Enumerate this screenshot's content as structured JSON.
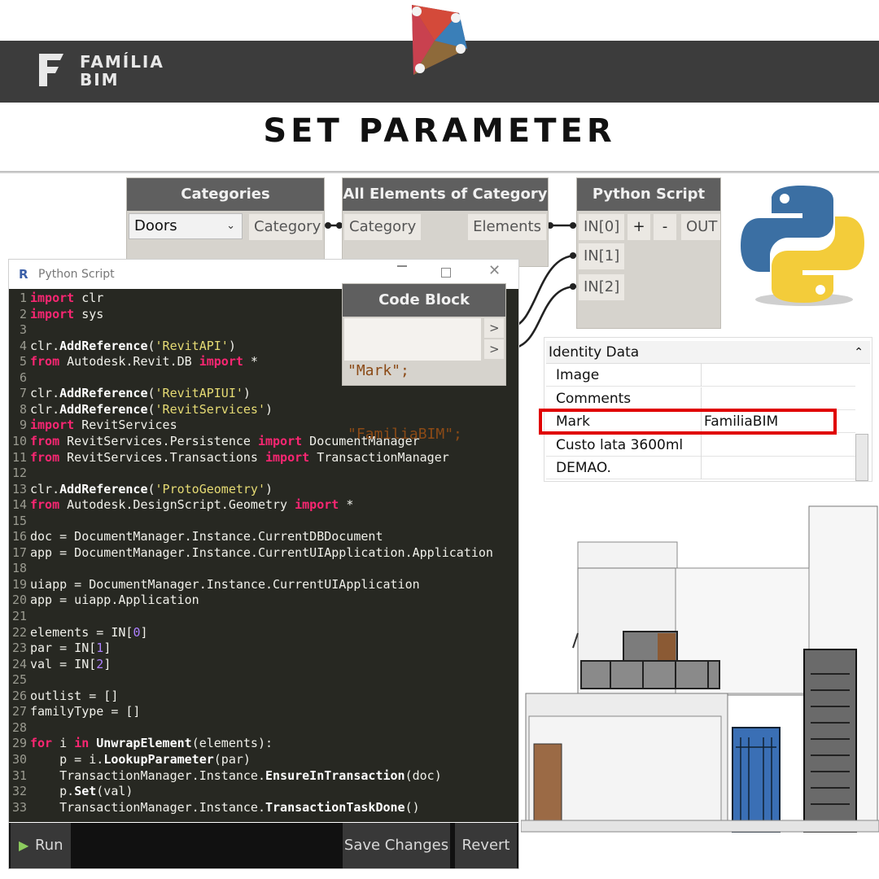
{
  "brand": {
    "line1": "FAMÍLIA",
    "line2": "BIM"
  },
  "title": "SET PARAMETER",
  "nodes": {
    "categories": {
      "title": "Categories",
      "dropdown_value": "Doors",
      "output": "Category"
    },
    "all_elements": {
      "title": "All Elements of Category",
      "input": "Category",
      "output": "Elements"
    },
    "python_node": {
      "title": "Python Script",
      "inputs": [
        "IN[0]",
        "IN[1]",
        "IN[2]"
      ],
      "plus": "+",
      "minus": "-",
      "output": "OUT"
    },
    "code_block": {
      "title": "Code Block",
      "lines": [
        "\"Mark\";",
        "\"FamiliaBIM\";"
      ],
      "port": ">"
    }
  },
  "python_window": {
    "title": "Python Script",
    "buttons": {
      "run": "Run",
      "save": "Save Changes",
      "revert": "Revert"
    },
    "code_lines": [
      "import clr",
      "import sys",
      "",
      "clr.AddReference('RevitAPI')",
      "from Autodesk.Revit.DB import *",
      "",
      "clr.AddReference('RevitAPIUI')",
      "clr.AddReference('RevitServices')",
      "import RevitServices",
      "from RevitServices.Persistence import DocumentManager",
      "from RevitServices.Transactions import TransactionManager",
      "",
      "clr.AddReference('ProtoGeometry')",
      "from Autodesk.DesignScript.Geometry import *",
      "",
      "doc = DocumentManager.Instance.CurrentDBDocument",
      "app = DocumentManager.Instance.CurrentUIApplication.Application",
      "",
      "uiapp = DocumentManager.Instance.CurrentUIApplication",
      "app = uiapp.Application",
      "",
      "elements = IN[0]",
      "par = IN[1]",
      "val = IN[2]",
      "",
      "outlist = []",
      "familyType = []",
      "",
      "for i in UnwrapElement(elements):",
      "    p = i.LookupParameter(par)",
      "    TransactionManager.Instance.EnsureInTransaction(doc)",
      "    p.Set(val)",
      "    TransactionManager.Instance.TransactionTaskDone()"
    ]
  },
  "identity_data": {
    "header": "Identity Data",
    "rows": [
      {
        "label": "Image",
        "value": ""
      },
      {
        "label": "Comments",
        "value": ""
      },
      {
        "label": "Mark",
        "value": "FamiliaBIM"
      },
      {
        "label": "Custo lata 3600ml",
        "value": ""
      },
      {
        "label": "DEMAO.",
        "value": ""
      }
    ]
  },
  "colors": {
    "banner": "#3c3c3c",
    "highlight": "#e00000",
    "editor_bg": "#272822",
    "keyword": "#f92672",
    "string": "#e6db74"
  }
}
